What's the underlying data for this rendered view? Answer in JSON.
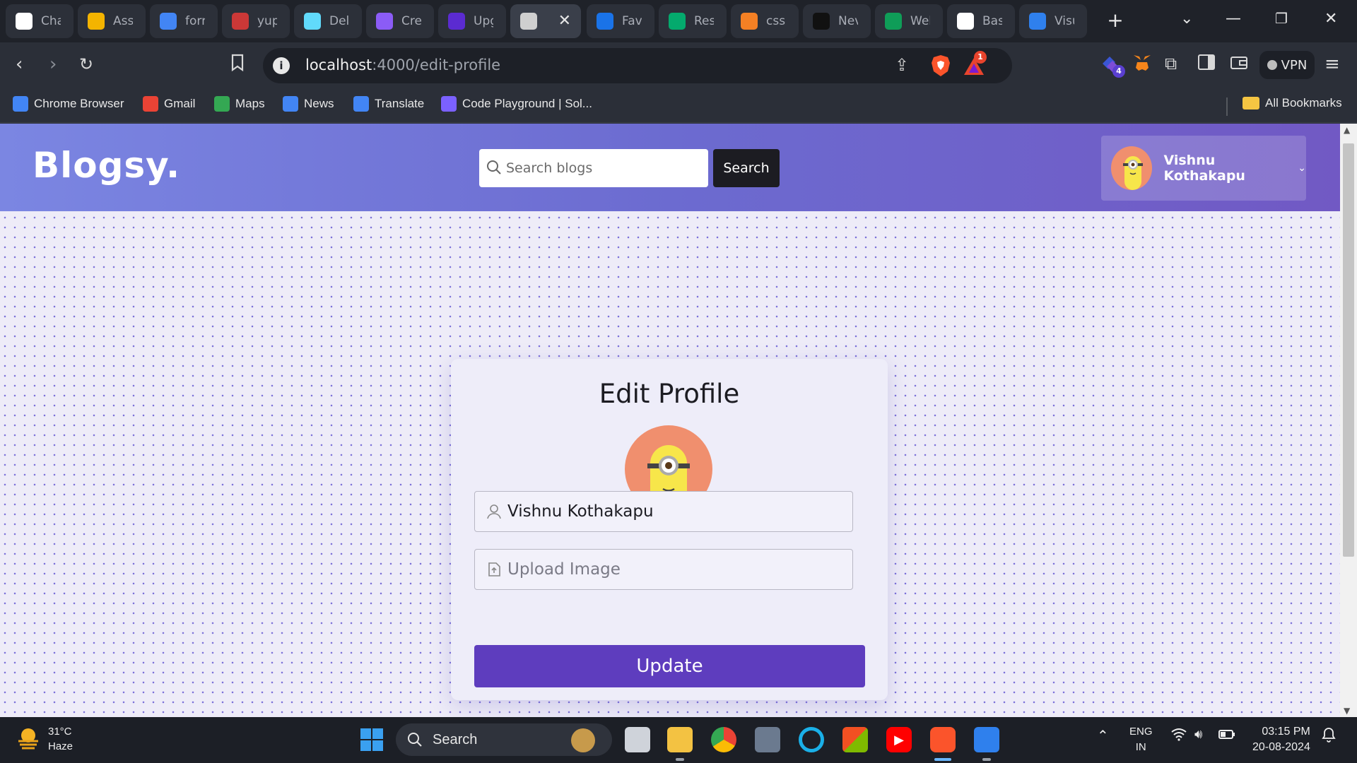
{
  "tabs": [
    {
      "title": "Cha",
      "icon": "chatgpt-icon",
      "color": "#ffffff"
    },
    {
      "title": "Assi",
      "icon": "classroom-icon",
      "color": "#f4b400"
    },
    {
      "title": "forr",
      "icon": "google-icon",
      "color": "#4285f4"
    },
    {
      "title": "yup",
      "icon": "npm-icon",
      "color": "#cb3837"
    },
    {
      "title": "Del",
      "icon": "react-icon",
      "color": "#61dafb"
    },
    {
      "title": "Cre",
      "icon": "shield-icon",
      "color": "#8b5cf6"
    },
    {
      "title": "Upg",
      "icon": "purple-gem-icon",
      "color": "#5b2bd1"
    },
    {
      "title": "",
      "icon": "globe-icon",
      "color": "#cfcfcf"
    },
    {
      "title": "Favi",
      "icon": "favicon-f-icon",
      "color": "#1a73e8"
    },
    {
      "title": "Res",
      "icon": "w3schools-icon",
      "color": "#04aa6d"
    },
    {
      "title": "css",
      "icon": "stackoverflow-icon",
      "color": "#f48024"
    },
    {
      "title": "Nev",
      "icon": "dark-circle-icon",
      "color": "#111111"
    },
    {
      "title": "Wel",
      "icon": "google-drive-icon",
      "color": "#0f9d58"
    },
    {
      "title": "Basi",
      "icon": "github-icon",
      "color": "#ffffff"
    },
    {
      "title": "Visu",
      "icon": "vscode-icon",
      "color": "#2f80ed"
    }
  ],
  "address": {
    "host": "localhost",
    "path": ":4000/edit-profile",
    "rewards_badge": "1"
  },
  "toolbar": {
    "extensions_badge": "4",
    "vpn_label": "VPN"
  },
  "bookmarks": [
    {
      "label": "Chrome Browser",
      "icon": "chrome-icon",
      "color": "#4285f4"
    },
    {
      "label": "Gmail",
      "icon": "gmail-icon",
      "color": "#ea4335"
    },
    {
      "label": "Maps",
      "icon": "maps-icon",
      "color": "#34a853"
    },
    {
      "label": "News",
      "icon": "news-icon",
      "color": "#4285f4"
    },
    {
      "label": "Translate",
      "icon": "translate-icon",
      "color": "#4285f4"
    },
    {
      "label": "Code Playground | Sol...",
      "icon": "code-playground-icon",
      "color": "#7b61ff"
    }
  ],
  "all_bookmarks_label": "All Bookmarks",
  "site": {
    "logo": "Blogsy.",
    "search_placeholder": "Search blogs",
    "search_button": "Search",
    "user_name": "Vishnu Kothakapu"
  },
  "edit_profile": {
    "title": "Edit Profile",
    "name_value": "Vishnu Kothakapu",
    "upload_placeholder": "Upload Image",
    "update_button": "Update"
  },
  "taskbar": {
    "temperature": "31°C",
    "weather": "Haze",
    "search_label": "Search",
    "lang": "ENG",
    "region": "IN",
    "time": "03:15 PM",
    "date": "20-08-2024"
  },
  "colors": {
    "brand_header_start": "#7b86e2",
    "brand_header_end": "#7159c4",
    "update_button": "#5e3dbe",
    "search_button": "#1c1c22"
  }
}
